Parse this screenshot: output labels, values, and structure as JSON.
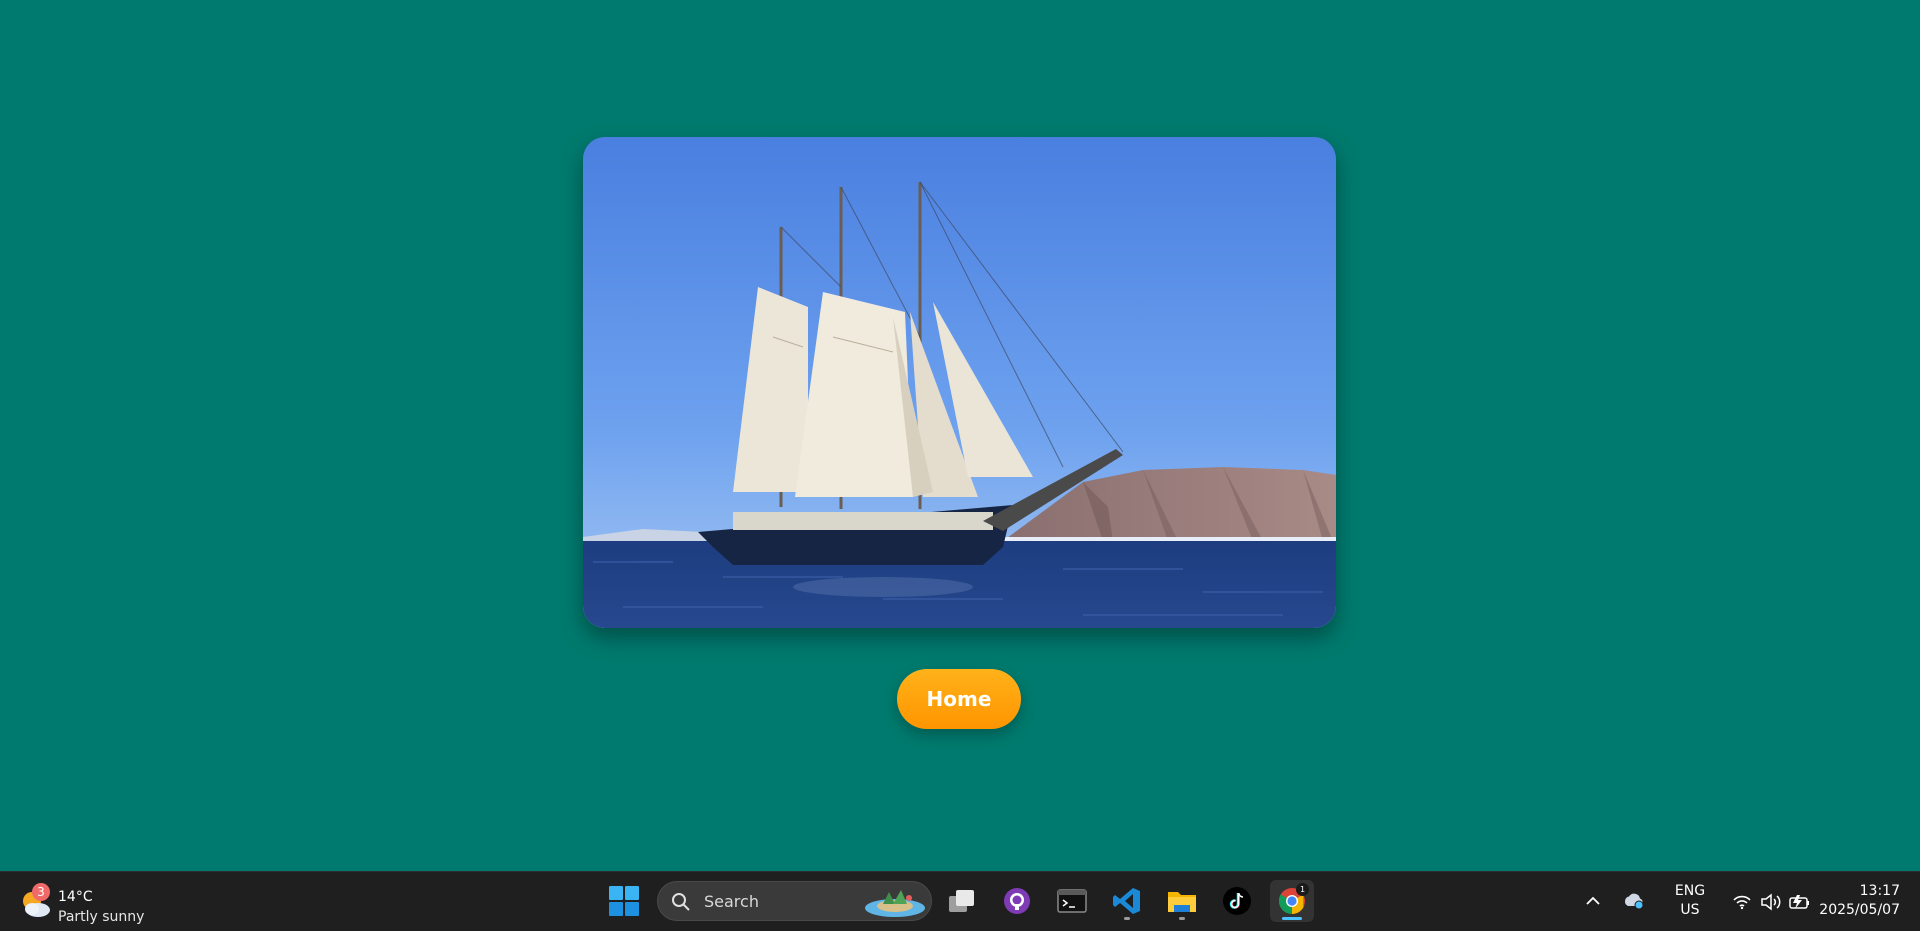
{
  "main": {
    "image_alt": "Sailing ship",
    "home_button": "Home"
  },
  "taskbar": {
    "weather": {
      "badge": "3",
      "temperature": "14°C",
      "condition": "Partly sunny",
      "icon": "partly-sunny-icon"
    },
    "search_placeholder": "Search",
    "apps": [
      {
        "name": "start",
        "icon": "windows-logo-icon"
      },
      {
        "name": "task-view",
        "icon": "task-view-icon"
      },
      {
        "name": "github-desktop",
        "icon": "github-icon"
      },
      {
        "name": "terminal",
        "icon": "terminal-icon"
      },
      {
        "name": "vscode",
        "icon": "vscode-icon"
      },
      {
        "name": "file-explorer",
        "icon": "folder-icon"
      },
      {
        "name": "tiktok",
        "icon": "tiktok-icon"
      },
      {
        "name": "chrome",
        "icon": "chrome-icon",
        "badge": "1"
      }
    ],
    "tray": {
      "language_line1": "ENG",
      "language_line2": "US",
      "time": "13:17",
      "date": "2025/05/07"
    }
  },
  "colors": {
    "background": "#007a6e",
    "button": "#ff9f0a",
    "taskbar": "#1f1f1f",
    "accent": "#4cc2ff"
  }
}
